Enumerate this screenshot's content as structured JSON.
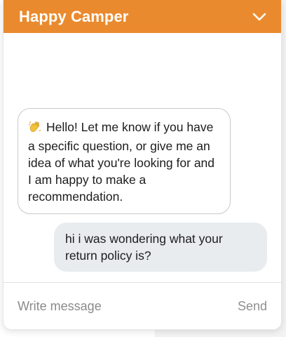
{
  "header": {
    "title": "Happy Camper",
    "collapse_icon": "chevron-down-icon"
  },
  "colors": {
    "header_bg": "#ea8a2e",
    "user_bubble_bg": "#e9ecef",
    "bot_bubble_border": "#c9c9c9"
  },
  "messages": [
    {
      "sender": "bot",
      "icon": "waving-hand-icon",
      "text": "Hello! Let me know if you have a specific question, or give me an idea of what you're looking for and I am happy to make a recommendation."
    },
    {
      "sender": "user",
      "text": "hi i was wondering what your return policy is?"
    }
  ],
  "composer": {
    "placeholder": "Write message",
    "value": "",
    "send_label": "Send"
  }
}
